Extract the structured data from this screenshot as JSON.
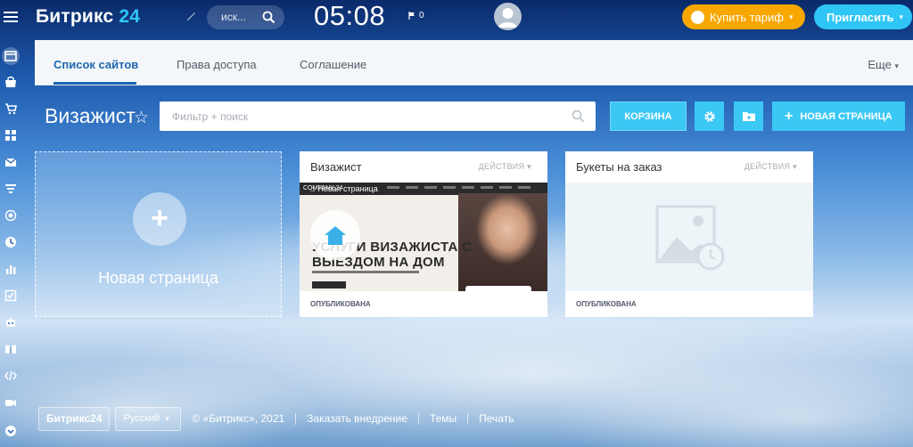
{
  "topbar": {
    "logo_text": "Битрикс",
    "logo_num": "24",
    "search_placeholder": "иск...",
    "clock": "05:08",
    "flag_count": "0",
    "buy_label": "Купить тариф",
    "invite_label": "Пригласить"
  },
  "tabs": {
    "items": [
      "Список сайтов",
      "Права доступа",
      "Соглашение"
    ],
    "active": "Список сайтов",
    "more_label": "Еще"
  },
  "toolbar": {
    "page_title": "Визажист",
    "filter_placeholder": "Фильтр + поиск",
    "trash_label": "КОРЗИНА",
    "new_page_label": "НОВАЯ СТРАНИЦА"
  },
  "new_tile": {
    "label": "Новая страница"
  },
  "cards": [
    {
      "title": "Визажист",
      "actions_label": "ДЕЙСТВИЯ",
      "status": "ОПУБЛИКОВАНА",
      "preview_logo": "COMPANY 24",
      "preview_breadcrumb": "Новая страница",
      "preview_hero": "УСЛУГИ ВИЗАЖИСТА С ВЫЕЗДОМ НА ДОМ"
    },
    {
      "title": "Букеты на заказ",
      "actions_label": "ДЕЙСТВИЯ",
      "status": "ОПУБЛИКОВАНА"
    }
  ],
  "footer": {
    "logo": "Битрикс24",
    "language": "Русский",
    "copyright": "© «Битрикс», 2021",
    "order_link": "Заказать внедрение",
    "themes_link": "Темы",
    "print_link": "Печать"
  },
  "colors": {
    "accent": "#3bc8f5",
    "buy": "#f7a700",
    "tab_active": "#2067b0"
  }
}
